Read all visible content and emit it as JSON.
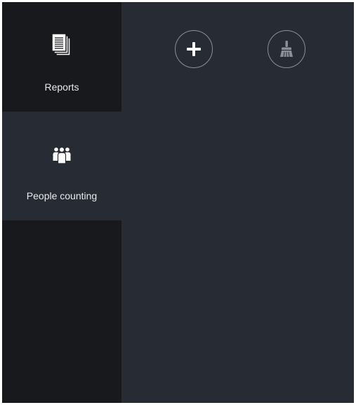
{
  "sidebar": {
    "items": [
      {
        "id": "reports",
        "label": "Reports",
        "icon": "documents-icon",
        "active": false
      },
      {
        "id": "people-counting",
        "label": "People counting",
        "icon": "people-group-icon",
        "active": true
      }
    ]
  },
  "toolbar": {
    "buttons": [
      {
        "id": "add",
        "icon": "plus-icon",
        "enabled": true
      },
      {
        "id": "clear",
        "icon": "broom-icon",
        "enabled": false
      }
    ]
  },
  "colors": {
    "sidebar_bg": "#18191d",
    "main_bg": "#272b33",
    "text": "#e9eaec",
    "button_border": "#8b8f98",
    "icon_active": "#ffffff",
    "icon_disabled": "#8b8f98"
  }
}
